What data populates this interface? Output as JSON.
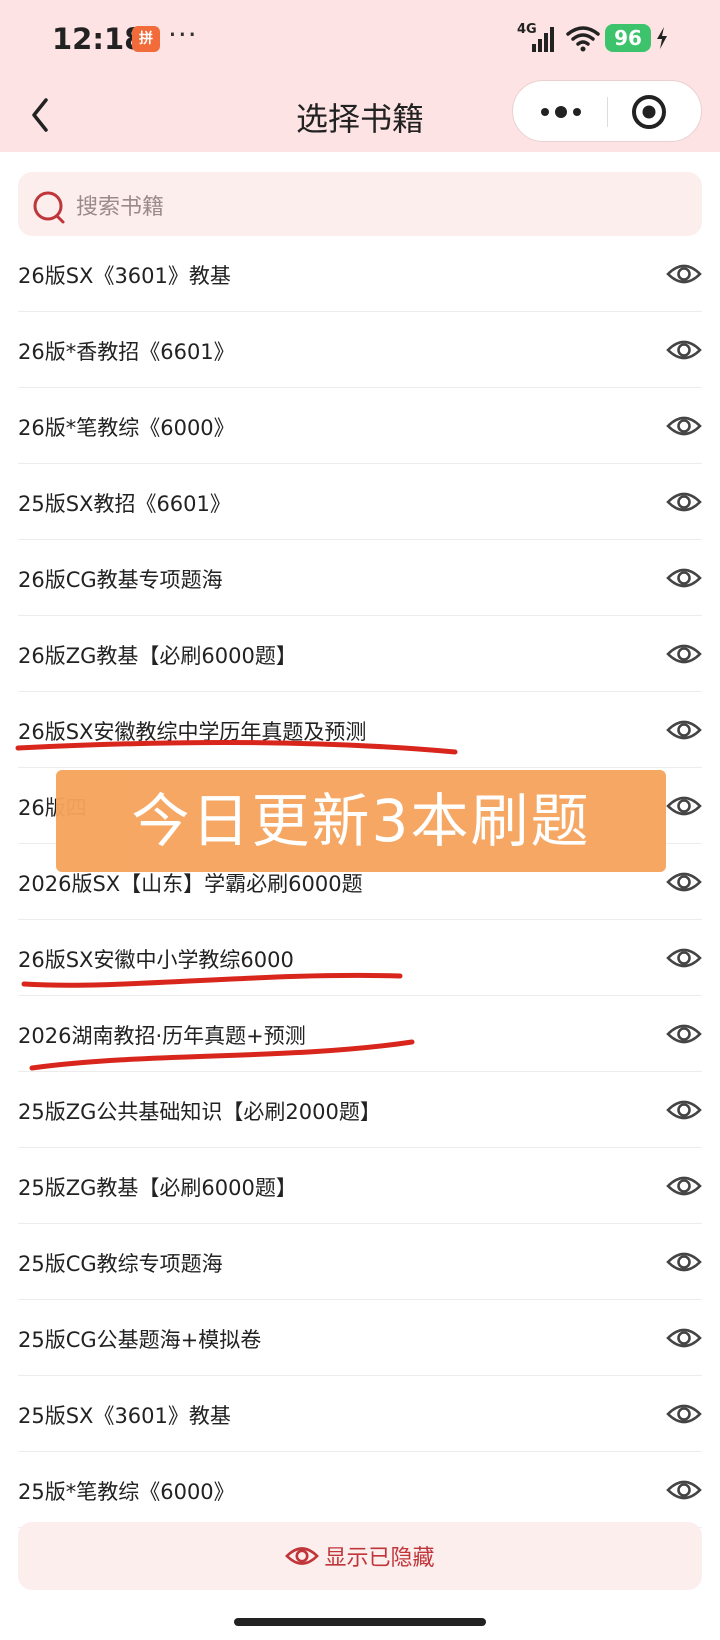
{
  "status_bar": {
    "time": "12:18",
    "app_badge": "拼",
    "dots": "···",
    "network": "4G",
    "battery": "96"
  },
  "nav": {
    "title": "选择书籍",
    "back_icon": "chevron-left-icon",
    "more_icon": "more-dots-icon",
    "close_icon": "target-circle-icon"
  },
  "search": {
    "placeholder": "搜索书籍"
  },
  "books": [
    {
      "title": "26版SX《3601》教基"
    },
    {
      "title": "26版*香教招《6601》"
    },
    {
      "title": "26版*笔教综《6000》"
    },
    {
      "title": "25版SX教招《6601》"
    },
    {
      "title": "26版CG教基专项题海"
    },
    {
      "title": "26版ZG教基【必刷6000题】"
    },
    {
      "title": "26版SX安徽教综中学历年真题及预测"
    },
    {
      "title": "26版四"
    },
    {
      "title": "2026版SX【山东】学霸必刷6000题"
    },
    {
      "title": "26版SX安徽中小学教综6000"
    },
    {
      "title": "2026湖南教招·历年真题+预测"
    },
    {
      "title": "25版ZG公共基础知识【必刷2000题】"
    },
    {
      "title": "25版ZG教基【必刷6000题】"
    },
    {
      "title": "25版CG教综专项题海"
    },
    {
      "title": "25版CG公基题海+模拟卷"
    },
    {
      "title": "25版SX《3601》教基"
    },
    {
      "title": "25版*笔教综《6000》"
    }
  ],
  "banner": {
    "text": "今日更新3本刷题",
    "color": "#f6a45d"
  },
  "bottom": {
    "show_hidden_label": "显示已隐藏",
    "accent": "#c0353a"
  }
}
